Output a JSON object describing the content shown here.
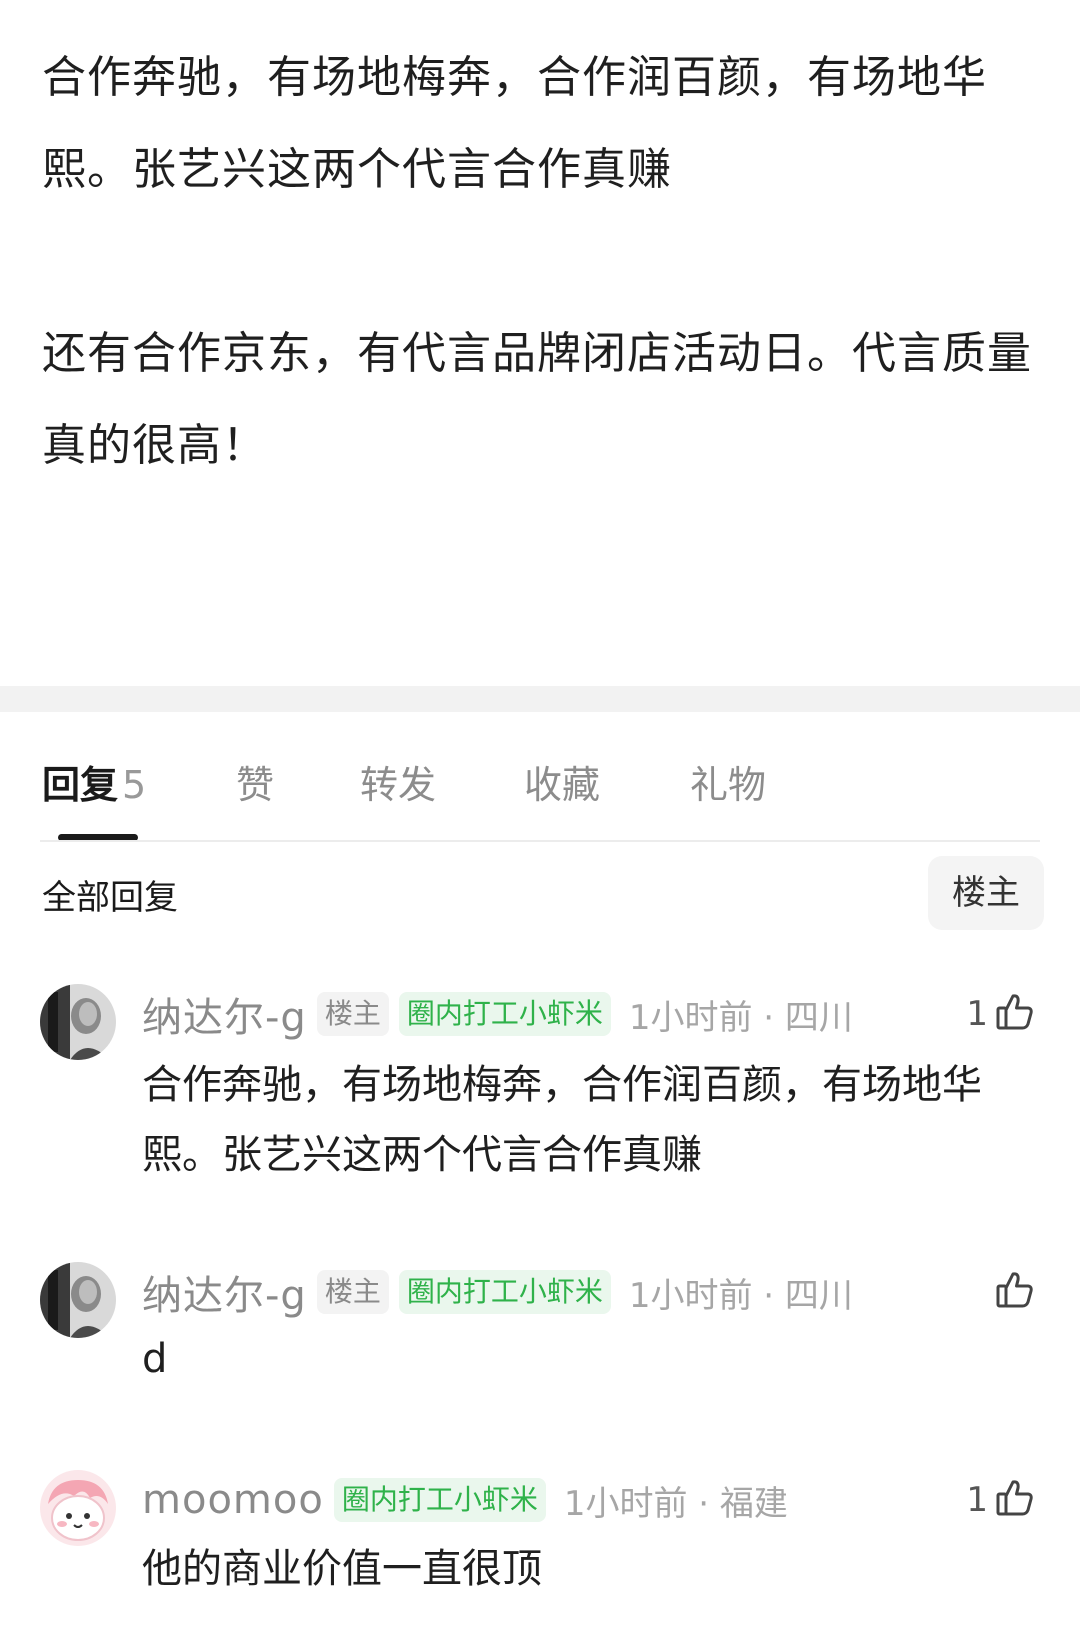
{
  "post": {
    "paragraphs": [
      "合作奔驰，有场地梅奔，合作润百颜，有场地华熙。张艺兴这两个代言合作真赚",
      "还有合作京东，有代言品牌闭店活动日。代言质量真的很高！"
    ]
  },
  "tabs": {
    "reply_label": "回复",
    "reply_count": "5",
    "like_label": "赞",
    "repost_label": "转发",
    "favorite_label": "收藏",
    "gift_label": "礼物"
  },
  "subheader": {
    "all_replies": "全部回复",
    "owner_filter": "楼主"
  },
  "replies": [
    {
      "username": "纳达尔-g",
      "owner_badge": "楼主",
      "fan_badge": "圈内打工小虾米",
      "time_location": "1小时前 · 四川",
      "like_count": "1",
      "text": "合作奔驰，有场地梅奔，合作润百颜，有场地华熙。张艺兴这两个代言合作真赚",
      "avatar_icon": "portrait-bw-avatar"
    },
    {
      "username": "纳达尔-g",
      "owner_badge": "楼主",
      "fan_badge": "圈内打工小虾米",
      "time_location": "1小时前 · 四川",
      "like_count": "",
      "text": "d",
      "avatar_icon": "portrait-bw-avatar"
    },
    {
      "username": "moomoo",
      "fan_badge": "圈内打工小虾米",
      "time_location": "1小时前 · 福建",
      "like_count": "1",
      "text": "他的商业价值一直很顶",
      "avatar_icon": "cartoon-pink-avatar"
    }
  ],
  "colors": {
    "fan_badge_text": "#2fb24a",
    "fan_badge_bg": "#eaf7ed",
    "divider_band": "#f2f2f2"
  }
}
